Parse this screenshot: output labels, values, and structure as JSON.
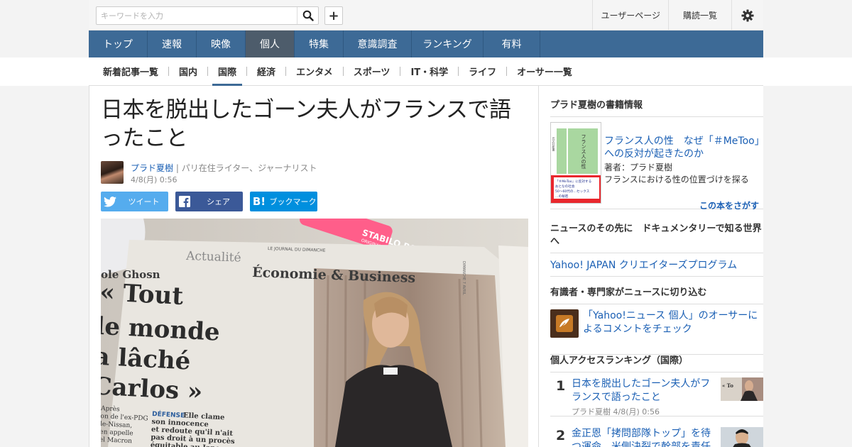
{
  "header": {
    "search_placeholder": "キーワードを入力",
    "user_page": "ユーザーページ",
    "subscriptions": "購読一覧"
  },
  "global_nav": [
    "トップ",
    "速報",
    "映像",
    "個人",
    "特集",
    "意識調査",
    "ランキング",
    "有料"
  ],
  "sub_nav": [
    "新着記事一覧",
    "国内",
    "国際",
    "経済",
    "エンタメ",
    "スポーツ",
    "IT・科学",
    "ライフ",
    "オーサー一覧"
  ],
  "article": {
    "title": "日本を脱出したゴーン夫人がフランスで語ったこと",
    "author": "プラド夏樹",
    "role": "パリ在住ライター、ジャーナリスト",
    "date": "4/8(月) 0:56",
    "share": {
      "tweet": "ツイート",
      "facebook": "シェア",
      "hatena": "ブックマーク"
    },
    "photo": {
      "header_left": "Actualité",
      "header_right": "Économie & Business",
      "paper_name": "LE JOURNAL DU DIMANCHE",
      "side_label": "DIMANCHE 7 AVRIL",
      "name_fragment": "ole Ghosn",
      "quote": [
        "« Tout",
        "le monde",
        "a lâché",
        "Carlos »"
      ],
      "body_left": "Après\non de l'ex-PDG\nle-Nissan,\nen appelle\nel Macron",
      "body_right_head": "DÉFENSE",
      "body_right": "Elle clame\nson innocence\net redoute qu'il n'ait\npas droit à un procès\néquitable au Japon",
      "marker_text": "STABILO BOSS",
      "marker_sub": "ORIGINAL"
    }
  },
  "sidebar": {
    "book": {
      "heading": "プラド夏樹の書籍情報",
      "title": "フランス人の性　なぜ「＃MeToo」への反対が起きたのか",
      "author": "著者：プラド夏樹",
      "desc": "フランスにおける性の位置づけを探る",
      "find": "この本をさがす",
      "cover_title": "フランス人の性",
      "cover_publisher": "光文社新書",
      "cover_band": "「＃MeToo」に反対する\nおとなの社会\n50〜60代の…セックス\n…の秘密"
    },
    "docu": {
      "heading": "ニュースのその先に　ドキュメンタリーで知る世界へ",
      "link": "Yahoo! JAPAN クリエイターズプログラム"
    },
    "experts": {
      "heading": "有識者・専門家がニュースに切り込む",
      "text": "「Yahoo!ニュース 個人」のオーサーによるコメントをチェック"
    },
    "ranking": {
      "heading": "個人アクセスランキング（国際）",
      "items": [
        {
          "num": "1",
          "title": "日本を脱出したゴーン夫人がフランスで語ったこと",
          "meta": "プラド夏樹  4/8(月) 0:56"
        },
        {
          "num": "2",
          "title": "金正恩「拷問部隊トップ」を待つ運命…米側決裂で幹部を責任",
          "meta": ""
        }
      ]
    }
  },
  "colors": {
    "nav_bg": "#3d6a96",
    "nav_active": "#4d5c6b",
    "link": "#1a5fb4",
    "twitter": "#55acee",
    "facebook": "#3b5998",
    "hatena": "#008fde"
  }
}
